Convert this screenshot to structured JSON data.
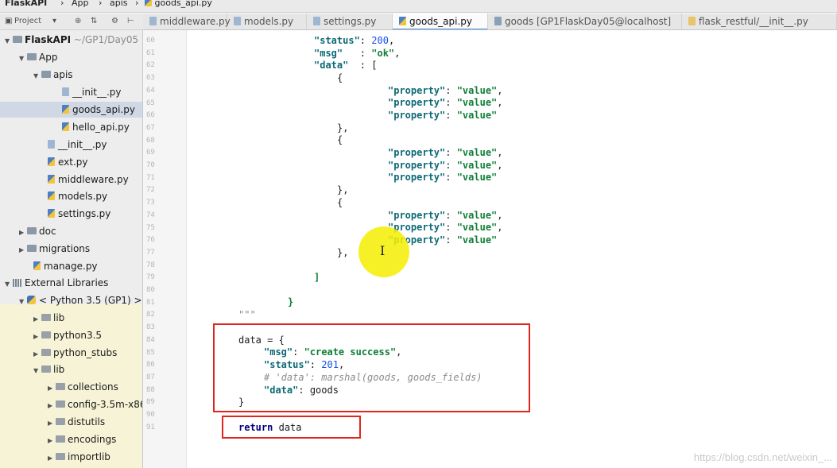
{
  "breadcrumb": [
    "FlaskAPI",
    "App",
    "apis",
    "goods_api.py"
  ],
  "project_toolbar": {
    "label": "Project",
    "icons": [
      "dropdown-icon",
      "sync-icon",
      "split-icon",
      "gear-icon",
      "collapse-icon"
    ]
  },
  "tabs": [
    {
      "label": "middleware.py",
      "active": false
    },
    {
      "label": "models.py",
      "active": false
    },
    {
      "label": "settings.py",
      "active": false
    },
    {
      "label": "goods_api.py",
      "active": true
    },
    {
      "label": "goods [GP1FlaskDay05@localhost]",
      "active": false
    },
    {
      "label": "flask_restful/__init__.py",
      "active": false
    }
  ],
  "tree": {
    "root": {
      "name": "FlaskAPI",
      "path": "~/GP1/Day05"
    },
    "items": [
      {
        "label": "App"
      },
      {
        "label": "apis"
      },
      {
        "label": "__init__.py"
      },
      {
        "label": "goods_api.py",
        "selected": true
      },
      {
        "label": "hello_api.py"
      },
      {
        "label": "__init__.py"
      },
      {
        "label": "ext.py"
      },
      {
        "label": "middleware.py"
      },
      {
        "label": "models.py"
      },
      {
        "label": "settings.py"
      },
      {
        "label": "doc"
      },
      {
        "label": "migrations"
      },
      {
        "label": "manage.py"
      },
      {
        "label": "External Libraries"
      },
      {
        "label": "< Python 3.5 (GP1) >"
      },
      {
        "label": "lib"
      },
      {
        "label": "python3.5"
      },
      {
        "label": "python_stubs"
      },
      {
        "label": "lib"
      },
      {
        "label": "collections"
      },
      {
        "label": "config-3.5m-x86"
      },
      {
        "label": "distutils"
      },
      {
        "label": "encodings"
      },
      {
        "label": "importlib"
      }
    ]
  },
  "gutter": {
    "line_numbers": [
      "60",
      "61",
      "62",
      "63",
      "64",
      "65",
      "66",
      "67",
      "68",
      "69",
      "70",
      "71",
      "72",
      "73",
      "74",
      "75",
      "76",
      "77",
      "78",
      "79",
      "80",
      "81",
      "82",
      "83",
      "84",
      "85",
      "86",
      "87",
      "88",
      "89",
      "90",
      "91"
    ]
  },
  "code": {
    "status_key": "\"status\"",
    "status_val": "200",
    "msg_key": "\"msg\"",
    "msg_val": "\"ok\"",
    "data_key": "\"data\"",
    "bracket_open": "[",
    "brace_open": "{",
    "prop_key": "\"property\"",
    "prop_val": "\"value\"",
    "brace_close_comma": "},",
    "bracket_close": "]",
    "brace_close": "}",
    "docstring_end": "\"\"\"",
    "assign_lhs": "data = {",
    "msg2_val": "\"create success\"",
    "status2_val": "201",
    "comment": "# 'data': marshal(goods, goods_fields)",
    "data2_val": "goods",
    "return_kw": "return",
    "return_val": "data"
  },
  "watermark": "https://blog.csdn.net/weixin_..."
}
